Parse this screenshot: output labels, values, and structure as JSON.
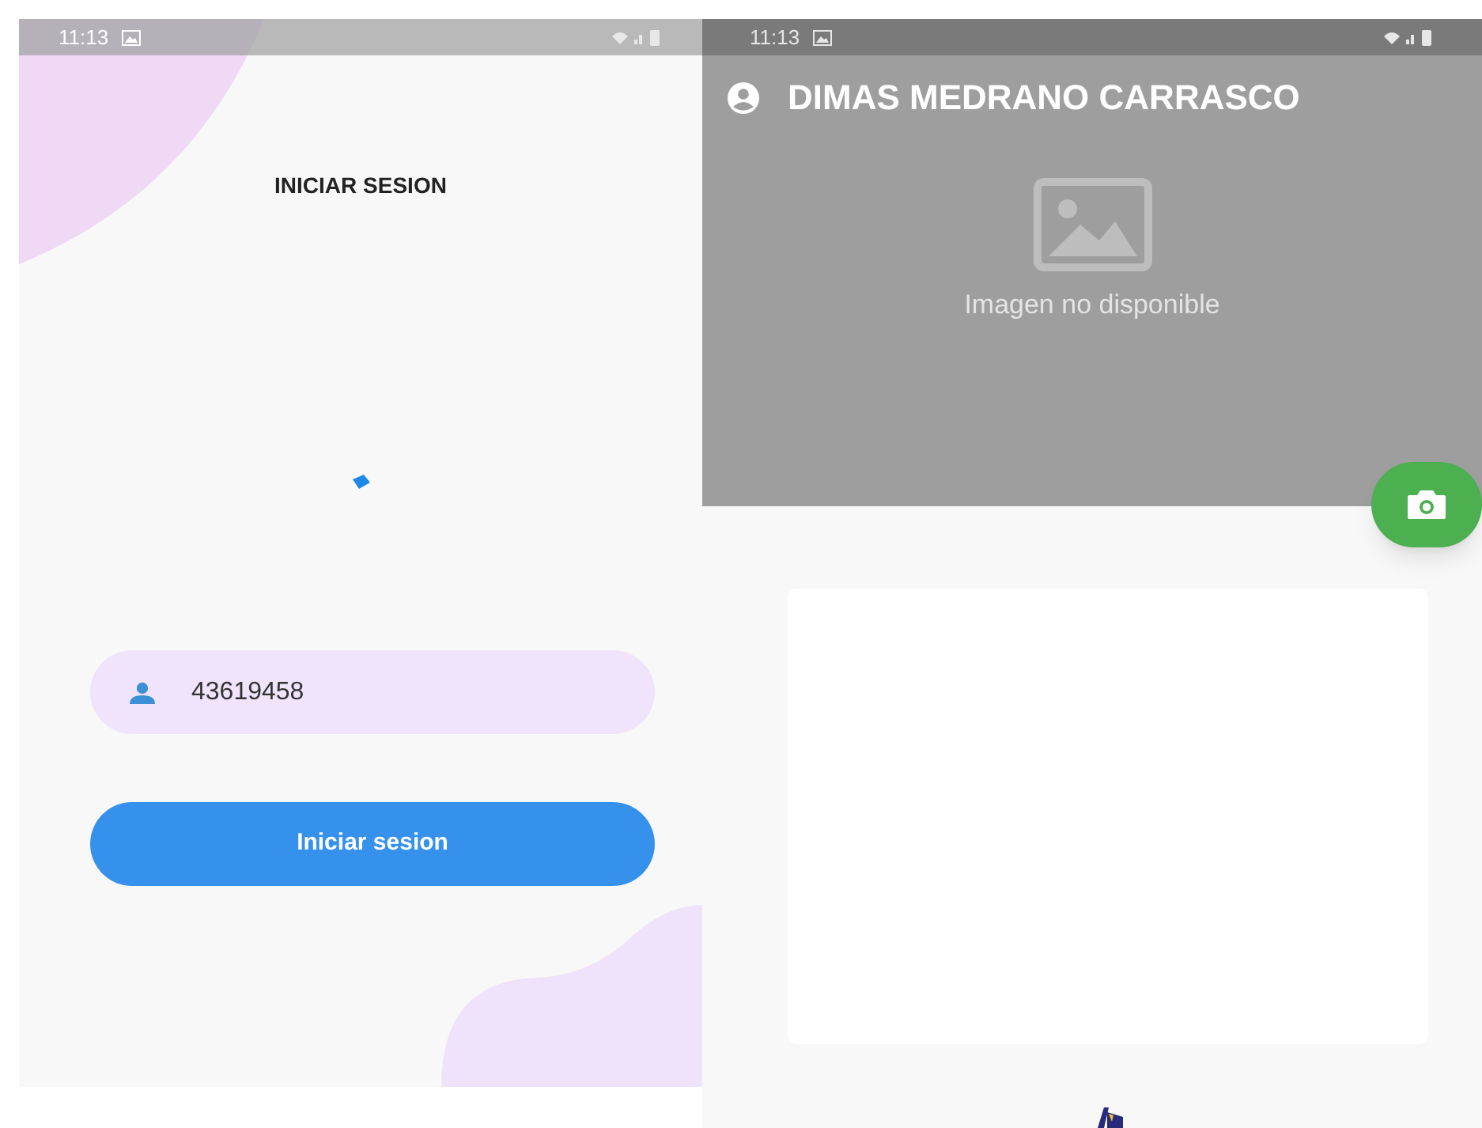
{
  "login_screen": {
    "status_bar": {
      "time": "11:13"
    },
    "title": "INICIAR SESION",
    "username_field": {
      "value": "43619458"
    },
    "login_button": {
      "label": "Iniciar sesion"
    }
  },
  "profile_screen": {
    "status_bar": {
      "time": "11:13"
    },
    "header": {
      "title": "DIMAS MEDRANO CARRASCO",
      "image_placeholder": "Imagen no disponible"
    }
  }
}
